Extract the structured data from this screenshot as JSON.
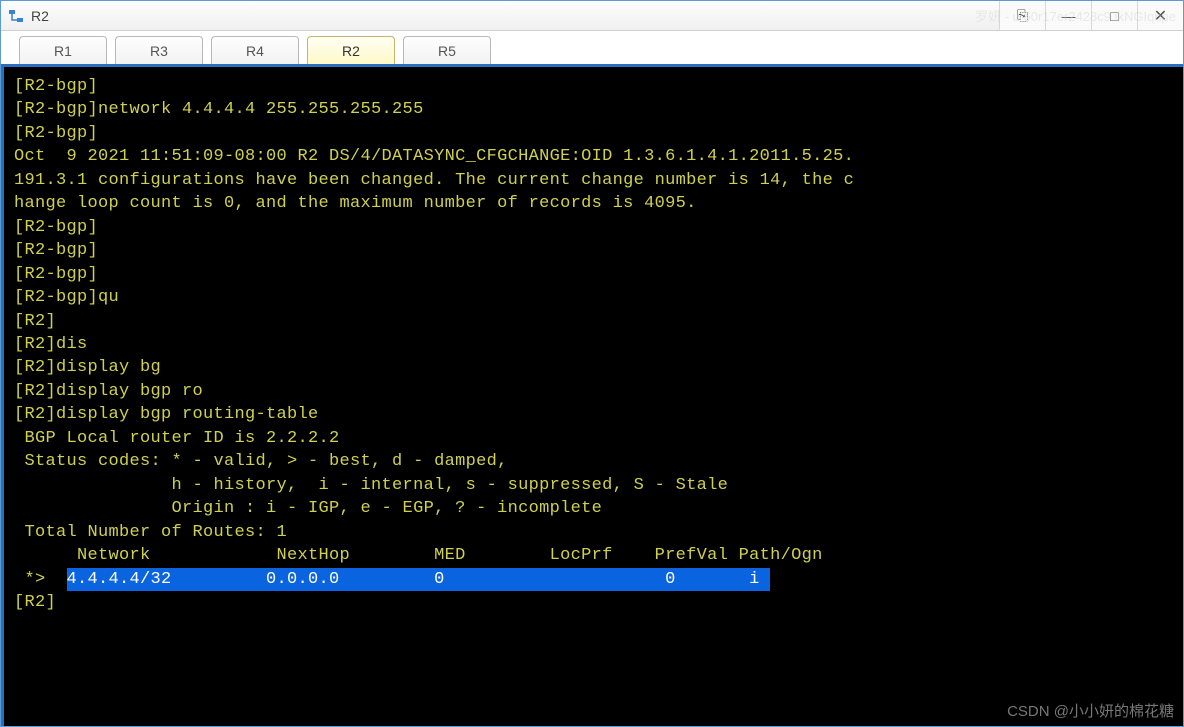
{
  "window": {
    "title": "R2"
  },
  "titlebar": {
    "buttons": {
      "extra": "⎘",
      "min": "—",
      "max": "□",
      "close": "✕"
    }
  },
  "tabs": [
    {
      "label": "R1",
      "active": false
    },
    {
      "label": "R3",
      "active": false
    },
    {
      "label": "R4",
      "active": false
    },
    {
      "label": "R2",
      "active": true
    },
    {
      "label": "R5",
      "active": false
    }
  ],
  "terminal": {
    "lines": [
      "[R2-bgp]",
      "[R2-bgp]network 4.4.4.4 255.255.255.255",
      "[R2-bgp]",
      "Oct  9 2021 11:51:09-08:00 R2 DS/4/DATASYNC_CFGCHANGE:OID 1.3.6.1.4.1.2011.5.25.",
      "191.3.1 configurations have been changed. The current change number is 14, the c",
      "hange loop count is 0, and the maximum number of records is 4095.",
      "[R2-bgp]",
      "[R2-bgp]",
      "[R2-bgp]",
      "[R2-bgp]qu",
      "[R2]",
      "[R2]dis",
      "[R2]display bg",
      "[R2]display bgp ro",
      "[R2]display bgp routing-table",
      "",
      " BGP Local router ID is 2.2.2.2",
      " Status codes: * - valid, > - best, d - damped,",
      "               h - history,  i - internal, s - suppressed, S - Stale",
      "               Origin : i - IGP, e - EGP, ? - incomplete",
      "",
      "",
      " Total Number of Routes: 1",
      "      Network            NextHop        MED        LocPrf    PrefVal Path/Ogn",
      ""
    ],
    "highlighted_prefix": " *>  ",
    "highlighted_row": "4.4.4.4/32         0.0.0.0         0                     0       i ",
    "final_prompt": "[R2]"
  },
  "watermarks": {
    "top": "罗妍 - u 60r17er2428c9 ikNGIqnpe",
    "bottom": "CSDN @小小妍的棉花糖"
  }
}
